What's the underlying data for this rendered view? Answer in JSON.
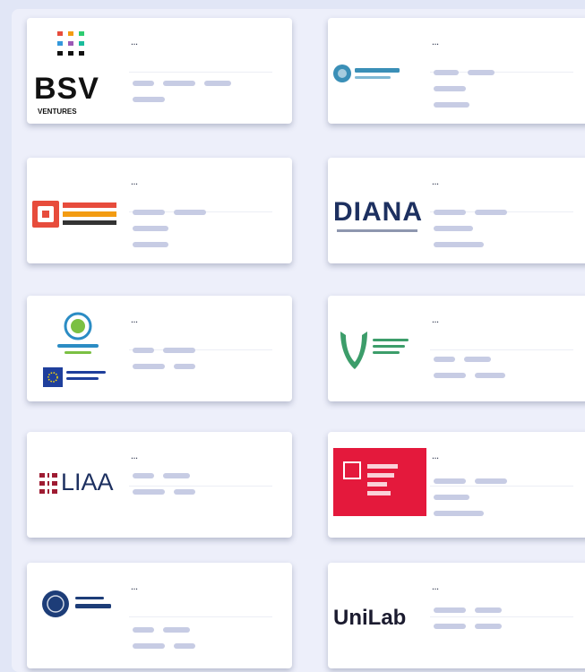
{
  "cards": [
    {
      "logo": "bsv-ventures-logo",
      "logo_text": "BSV",
      "logo_subtext": "VENTURES",
      "title": "…"
    },
    {
      "logo": "blue-circle-logo",
      "title": "…"
    },
    {
      "logo": "orange-frame-logo",
      "title": "…"
    },
    {
      "logo": "diana-logo",
      "logo_text": "DIANA",
      "title": "…"
    },
    {
      "logo": "green-circle-eu-flag-logo",
      "title": "…"
    },
    {
      "logo": "green-leaf-logo",
      "title": "…"
    },
    {
      "logo": "liaa-logo",
      "logo_text": "LIAA",
      "title": "…"
    },
    {
      "logo": "red-startup-logo",
      "title": "…"
    },
    {
      "logo": "university-seal-logo",
      "title": "…"
    },
    {
      "logo": "unilab-logo",
      "logo_text": "UniLab",
      "title": "…"
    }
  ]
}
